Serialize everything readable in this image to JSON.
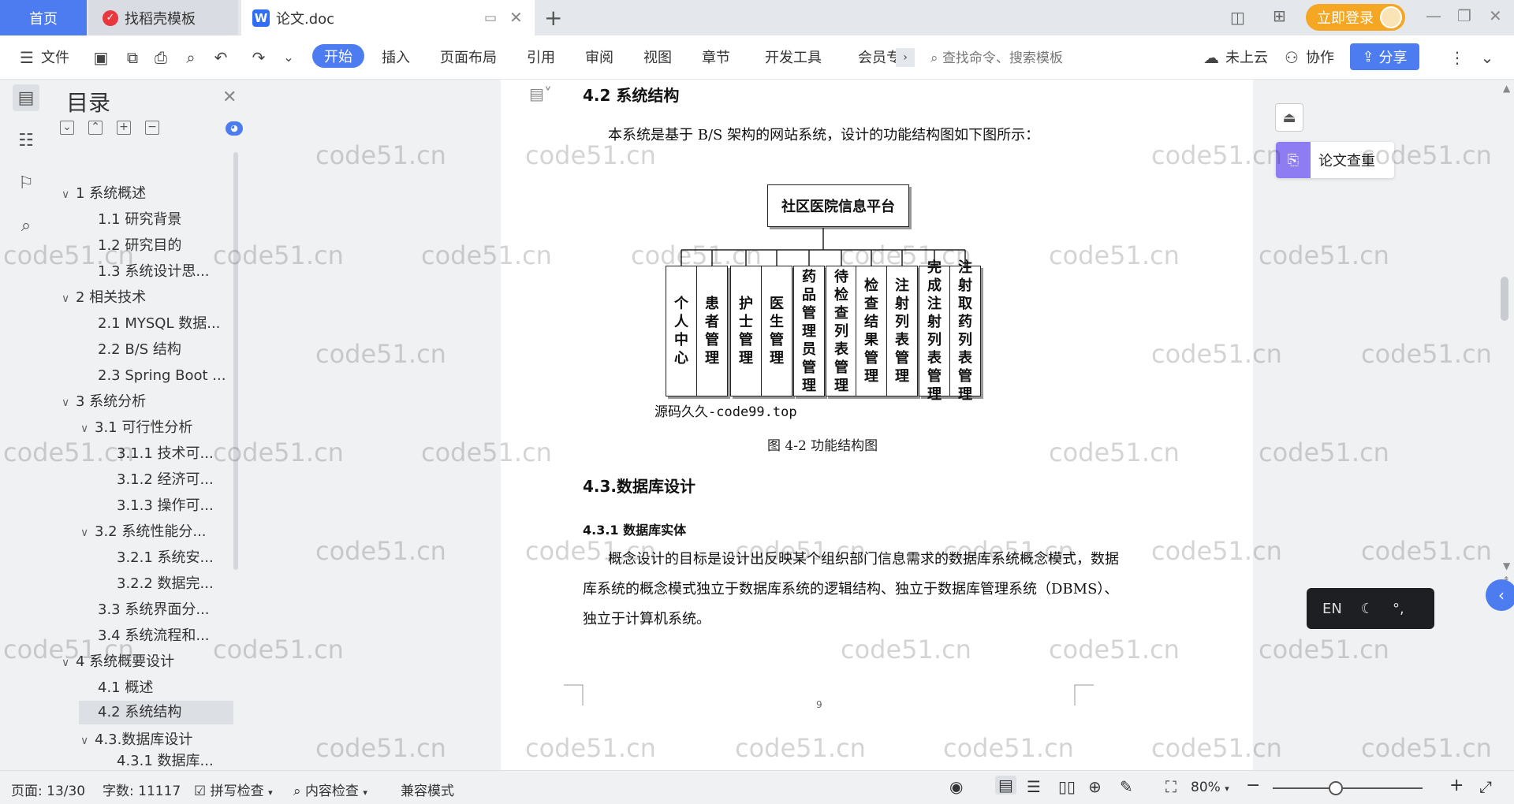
{
  "tabs": {
    "home": "首页",
    "dokeshell": "找稻壳模板",
    "doc": "论文.doc",
    "login": "立即登录"
  },
  "toolbar": {
    "file": "文件",
    "start": "开始",
    "insert": "插入",
    "layout": "页面布局",
    "reference": "引用",
    "review": "审阅",
    "view": "视图",
    "chapter": "章节",
    "devtools": "开发工具",
    "member": "会员专",
    "search_placeholder": "查找命令、搜索模板",
    "cloud": "未上云",
    "collab": "协作",
    "share": "分享"
  },
  "toc": {
    "title": "目录",
    "items": [
      {
        "label": "1 系统概述"
      },
      {
        "label": "1.1  研究背景"
      },
      {
        "label": "1.2 研究目的"
      },
      {
        "label": "1.3 系统设计思..."
      },
      {
        "label": "2 相关技术"
      },
      {
        "label": "2.1 MYSQL 数据..."
      },
      {
        "label": "2.2 B/S 结构"
      },
      {
        "label": "2.3 Spring Boot ..."
      },
      {
        "label": "3 系统分析"
      },
      {
        "label": "3.1 可行性分析"
      },
      {
        "label": "3.1.1 技术可..."
      },
      {
        "label": "3.1.2 经济可..."
      },
      {
        "label": "3.1.3 操作可..."
      },
      {
        "label": "3.2 系统性能分..."
      },
      {
        "label": "3.2.1  系统安..."
      },
      {
        "label": "3.2.2  数据完..."
      },
      {
        "label": "3.3 系统界面分..."
      },
      {
        "label": "3.4 系统流程和..."
      },
      {
        "label": "4 系统概要设计"
      },
      {
        "label": "4.1 概述"
      },
      {
        "label": "4.2 系统结构"
      },
      {
        "label": "4.3.数据库设计"
      },
      {
        "label": "4.3.1 数据库..."
      }
    ]
  },
  "doc": {
    "h42": "4.2 系统结构",
    "p1": "本系统是基于 B/S 架构的网站系统，设计的功能结构图如下图所示：",
    "diagram_root": "社区医院信息平台",
    "diagram_leaves": [
      "个人中心",
      "患者管理",
      "护士管理",
      "医生管理",
      "药品管理员管理",
      "待检查列表管理",
      "检查结果管理",
      "注射列表管理",
      "完成注射列表管理",
      "注射取药列表管理"
    ],
    "source_watermark": "源码久久-code99.top",
    "fig_caption": "图 4-2 功能结构图",
    "h43": "4.3.数据库设计",
    "h431": "4.3.1 数据库实体",
    "p2_line1": "概念设计的目标是设计出反映某个组织部门信息需求的数据库系统概念模式，数据",
    "p2_line2": "库系统的概念模式独立于数据库系统的逻辑结构、独立于数据库管理系统（DBMS）、",
    "p2_line3": "独立于计算机系统。",
    "page_number": "9"
  },
  "right_panel": {
    "plagiarism_check": "论文查重",
    "ime_lang": "EN"
  },
  "status": {
    "page": "页面: 13/30",
    "words": "字数: 11117",
    "spell": "拼写检查",
    "content_check": "内容检查",
    "compat": "兼容模式",
    "zoom": "80%"
  },
  "watermark_text": "code51.cn"
}
